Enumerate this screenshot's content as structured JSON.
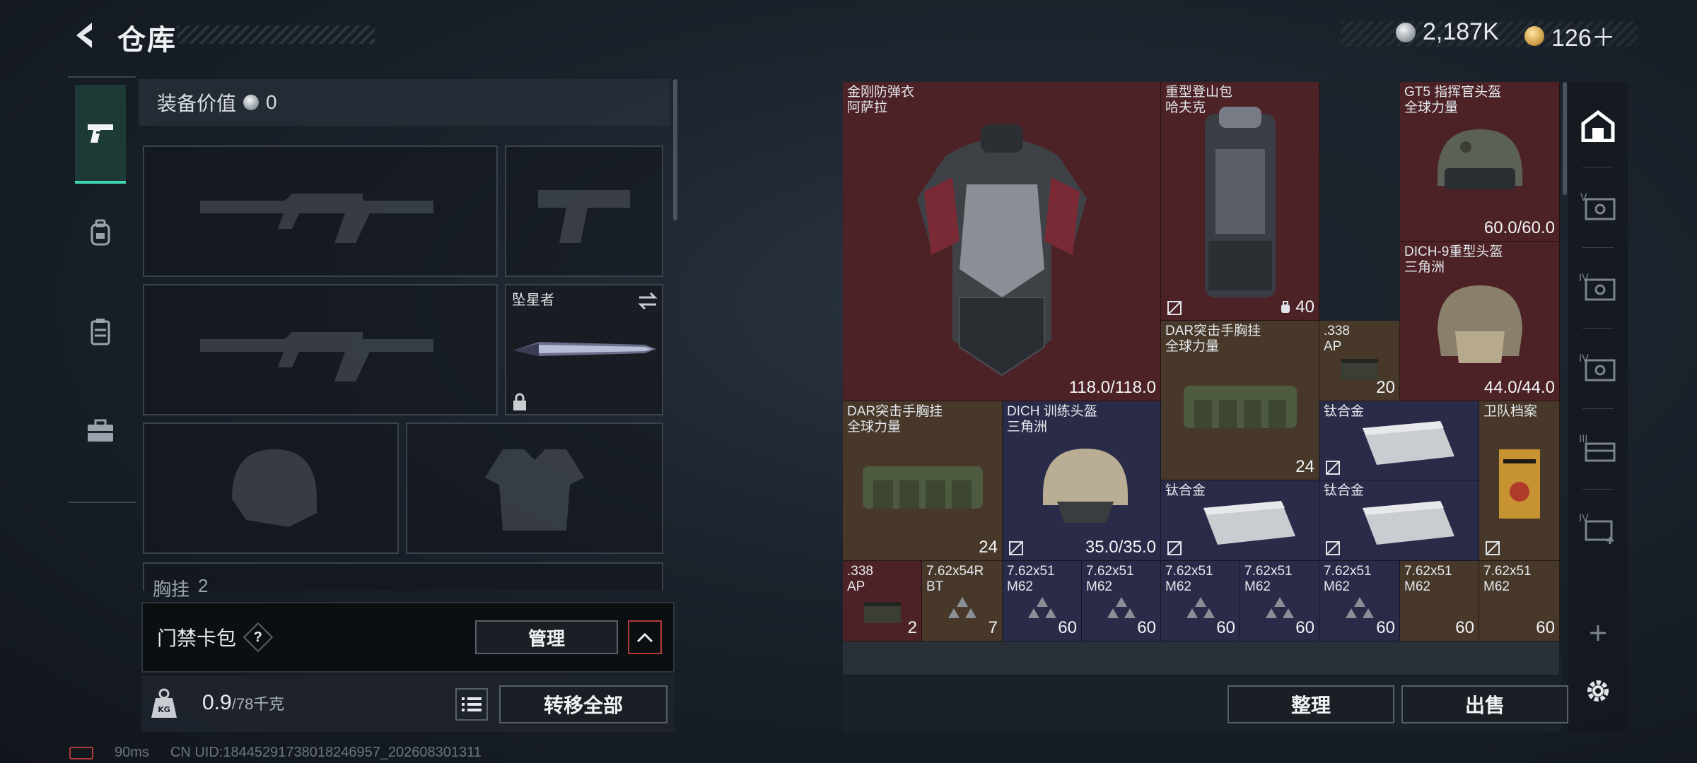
{
  "header": {
    "title": "仓库",
    "currency_silver": "2,187K",
    "currency_gold": "126＋"
  },
  "loadout": {
    "equip_value_label": "装备价值",
    "equip_value": "0",
    "melee_name": "坠星者",
    "chest_label": "胸挂",
    "chest_count": "2"
  },
  "keycard": {
    "label": "门禁卡包",
    "help": "?",
    "manage_label": "管理"
  },
  "capacity": {
    "current": "0.9",
    "max": "/78千克",
    "transfer_all_label": "转移全部"
  },
  "footer": {
    "ping": "90ms",
    "uid": "CN UID:18445291738018246957_202608301311"
  },
  "stash": {
    "items": [
      {
        "name": "金刚防弹衣\n阿萨拉",
        "value": "118.0/118.0",
        "rarity": "red"
      },
      {
        "name": "重型登山包\n哈夫克",
        "value": "40",
        "rarity": "red"
      },
      {
        "name": "GT5 指挥官头盔\n全球力量",
        "value": "60.0/60.0",
        "rarity": "red"
      },
      {
        "name": "DICH-9重型头盔\n三角洲",
        "value": "44.0/44.0",
        "rarity": "red"
      },
      {
        "name": "DAR突击手胸挂\n全球力量",
        "value": "24",
        "rarity": "gold"
      },
      {
        "name": ".338\nAP",
        "value": "20",
        "rarity": "gold"
      },
      {
        "name": "DAR突击手胸挂\n全球力量",
        "value": "24",
        "rarity": "gold"
      },
      {
        "name": "DICH 训练头盔\n三角洲",
        "value": "35.0/35.0",
        "rarity": "purple"
      },
      {
        "name": "钛合金",
        "value": "",
        "rarity": "purple"
      },
      {
        "name": "卫队档案",
        "value": "",
        "rarity": "gold"
      },
      {
        "name": "钛合金",
        "value": "",
        "rarity": "purple"
      },
      {
        "name": "钛合金",
        "value": "",
        "rarity": "purple"
      },
      {
        "name": ".338\nAP",
        "value": "2",
        "rarity": "red"
      },
      {
        "name": "7.62x54R\nBT",
        "value": "7",
        "rarity": "gold"
      },
      {
        "name": "7.62x51\nM62",
        "value": "60",
        "rarity": "purple"
      },
      {
        "name": "7.62x51\nM62",
        "value": "60",
        "rarity": "purple"
      },
      {
        "name": "7.62x51\nM62",
        "value": "60",
        "rarity": "purple"
      },
      {
        "name": "7.62x51\nM62",
        "value": "60",
        "rarity": "purple"
      },
      {
        "name": "7.62x51\nM62",
        "value": "60",
        "rarity": "purple"
      },
      {
        "name": "7.62x51\nM62",
        "value": "60",
        "rarity": "gold"
      },
      {
        "name": "7.62x51\nM62",
        "value": "60",
        "rarity": "gold"
      }
    ],
    "organize_label": "整理",
    "sell_label": "出售"
  },
  "right_rail": {
    "tier_labels": [
      "V",
      "IV",
      "IV",
      "III",
      "IV"
    ]
  }
}
